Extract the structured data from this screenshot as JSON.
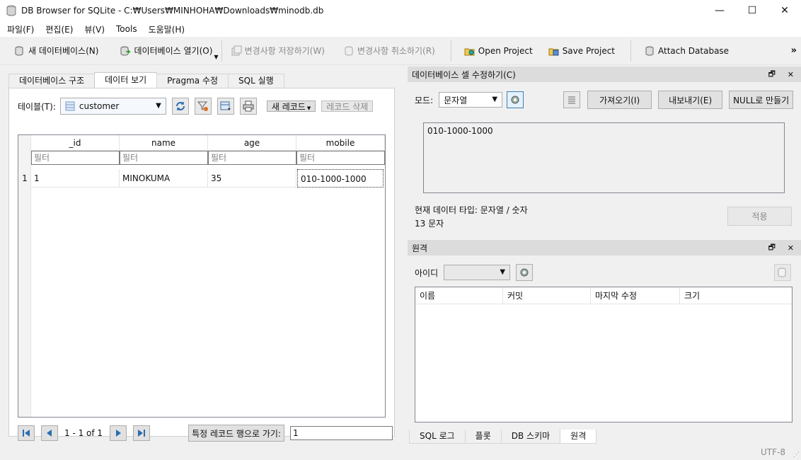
{
  "window": {
    "title": "DB Browser for SQLite - C:₩Users₩MINHOHA₩Downloads₩minodb.db",
    "minimize": "—",
    "maximize": "☐",
    "close": "✕"
  },
  "menu": [
    "파일(F)",
    "편집(E)",
    "뷰(V)",
    "Tools",
    "도움말(H)"
  ],
  "toolbar": {
    "new_db": "새 데이터베이스(N)",
    "open_db": "데이터베이스 열기(O)",
    "write_changes": "변경사항 저장하기(W)",
    "revert_changes": "변경사항 취소하기(R)",
    "open_project": "Open Project",
    "save_project": "Save Project",
    "attach_db": "Attach Database",
    "more": "»"
  },
  "tabs": [
    "데이터베이스 구조",
    "데이터 보기",
    "Pragma 수정",
    "SQL 실행"
  ],
  "browse": {
    "table_label": "테이블(T):",
    "table_value": "customer",
    "new_record": "새 레코드",
    "delete_record": "레코드 삭제",
    "columns": [
      "_id",
      "name",
      "age",
      "mobile"
    ],
    "filter_placeholder": "필터",
    "rows": [
      {
        "num": "1",
        "cells": [
          "1",
          "MINOKUMA",
          "35",
          "010-1000-1000"
        ]
      }
    ],
    "nav_text": "1 - 1 of 1",
    "goto_label": "특정 레코드 행으로 가기:",
    "goto_value": "1"
  },
  "edit_cell": {
    "title": "데이터베이스 셀 수정하기(C)",
    "mode_label": "모드:",
    "mode_value": "문자열",
    "import": "가져오기(I)",
    "export": "내보내기(E)",
    "set_null": "NULL로 만들기",
    "content": "010-1000-1000",
    "type_info": "현재 데이터 타입: 문자열 / 숫자",
    "size_info": "13 문자",
    "apply": "적용"
  },
  "remote": {
    "title": "원격",
    "identity_label": "아이디",
    "columns": [
      "이름",
      "커밋",
      "마지막 수정",
      "크기"
    ]
  },
  "bottom_tabs": [
    "SQL 로그",
    "플롯",
    "DB 스키마",
    "원격"
  ],
  "status": {
    "encoding": "UTF-8"
  }
}
